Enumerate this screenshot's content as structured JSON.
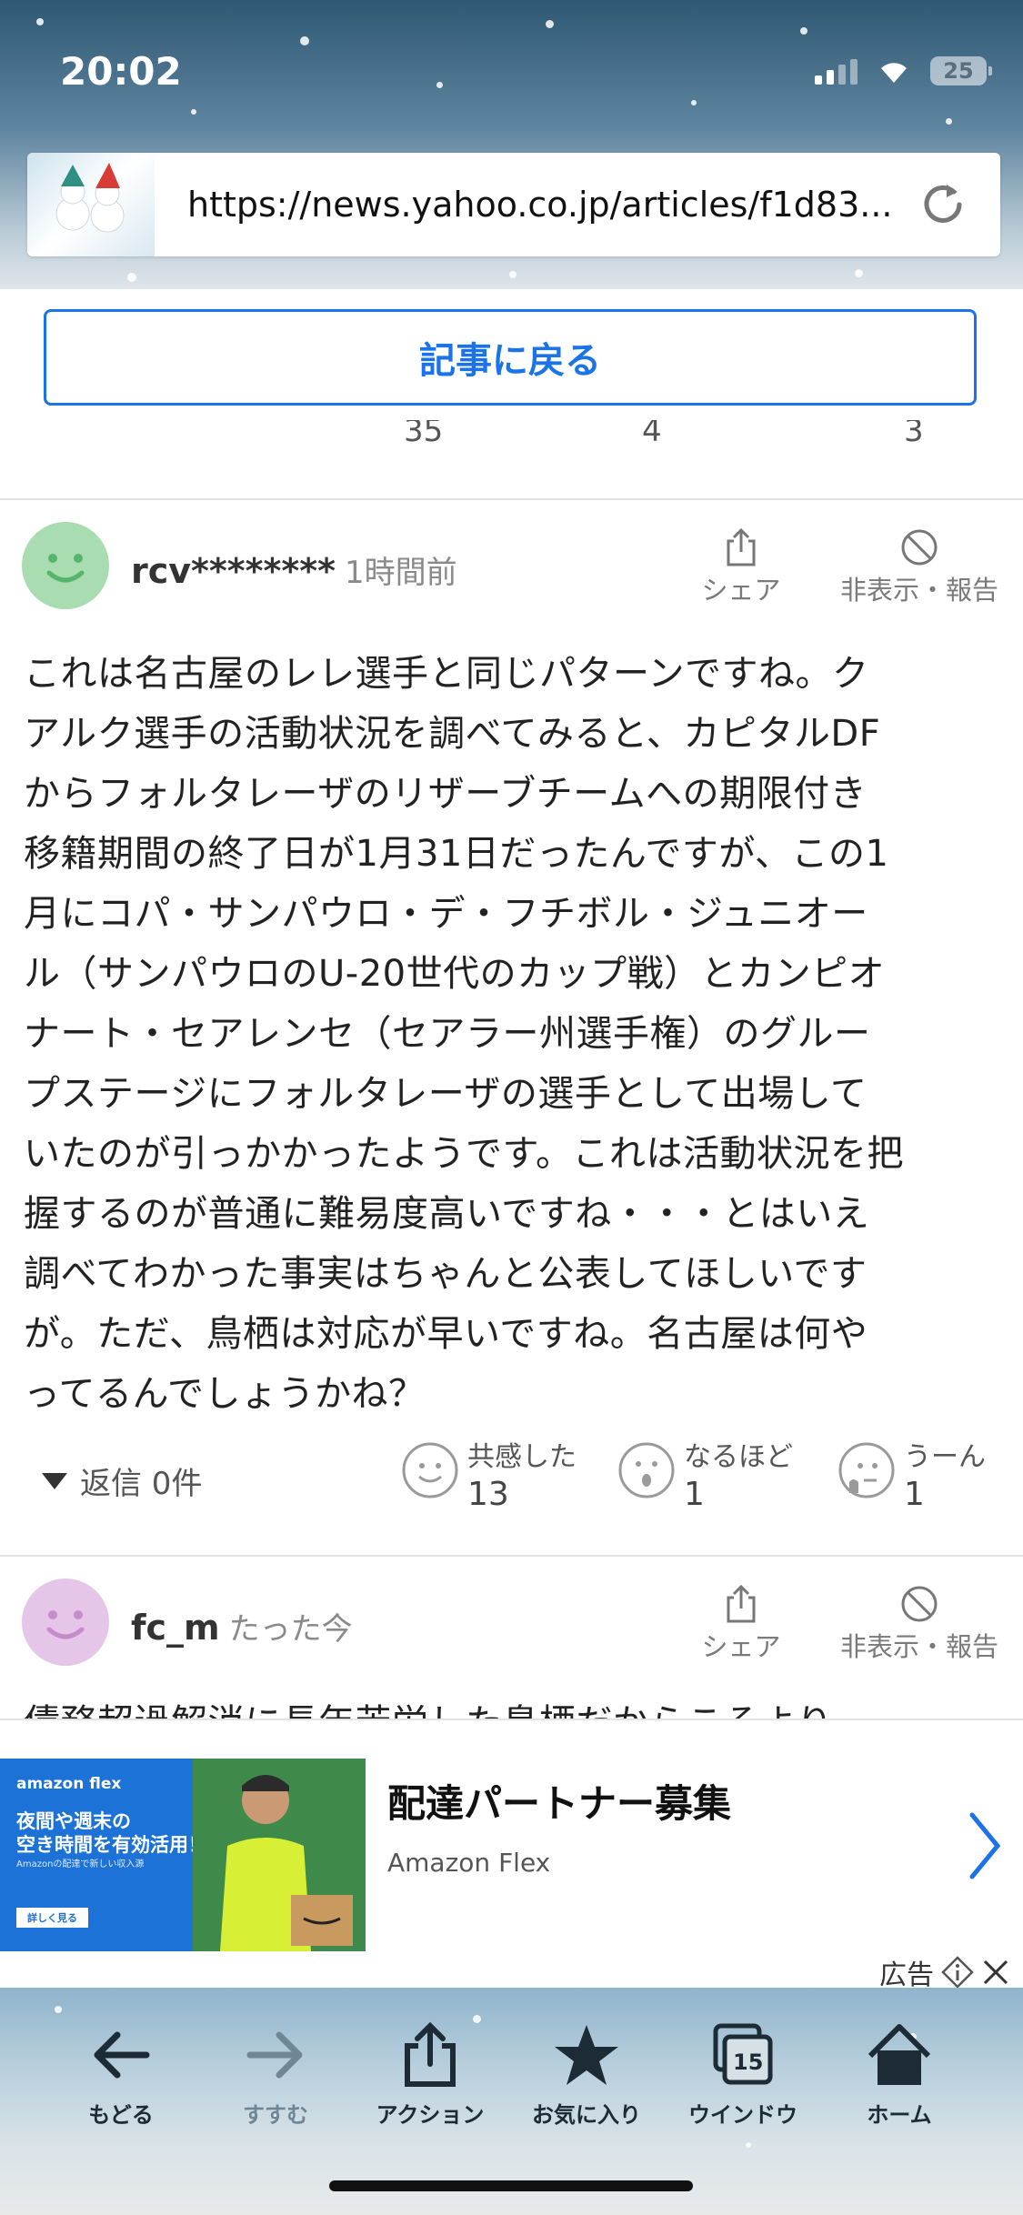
{
  "status": {
    "time": "20:02",
    "battery": "25"
  },
  "browser": {
    "url": "https://news.yahoo.co.jp/articles/f1d83..."
  },
  "back_button": "記事に戻る",
  "partial_counts": [
    "35",
    "4",
    "3"
  ],
  "comments": [
    {
      "user": "rcv********",
      "time": "1時間前",
      "share_label": "シェア",
      "hide_label": "非表示・報告",
      "lines": [
        "これは名古屋のレレ選手と同じパターンですね。ク",
        "アルク選手の活動状況を調べてみると、カピタルDF",
        "からフォルタレーザのリザーブチームへの期限付き",
        "移籍期間の終了日が1月31日だったんですが、この1",
        "月にコパ・サンパウロ・デ・フチボル・ジュニオー",
        "ル（サンパウロのU-20世代のカップ戦）とカンピオ",
        "ナート・セアレンセ（セアラー州選手権）のグルー",
        "プステージにフォルタレーザの選手として出場して",
        "いたのが引っかかったようです。これは活動状況を把",
        "握するのが普通に難易度高いですね・・・とはいえ",
        "調べてわかった事実はちゃんと公表してほしいです",
        "が。ただ、鳥栖は対応が早いですね。名古屋は何や",
        "ってるんでしょうかね？"
      ],
      "reply": "返信 0件",
      "reactions": [
        {
          "label": "共感した",
          "count": "13"
        },
        {
          "label": "なるほど",
          "count": "1"
        },
        {
          "label": "うーん",
          "count": "1"
        }
      ]
    },
    {
      "user": "fc_m",
      "time": "たった今",
      "share_label": "シェア",
      "hide_label": "非表示・報告",
      "partial_line": "債務超過解消に長年苦労した鳥栖だからこそより一"
    }
  ],
  "ad": {
    "brand": "amazon flex",
    "image_copy": "夜間や週末の\n空き時間を有効活用！",
    "image_small": "Amazonの配達で新しい収入源",
    "image_cta": "詳しく見る",
    "title": "配達パートナー募集",
    "sponsor": "Amazon Flex",
    "label": "広告"
  },
  "toolbar": [
    {
      "label": "もどる",
      "icon": "back-arrow-icon"
    },
    {
      "label": "すすむ",
      "icon": "forward-arrow-icon"
    },
    {
      "label": "アクション",
      "icon": "share-icon"
    },
    {
      "label": "お気に入り",
      "icon": "star-icon"
    },
    {
      "label": "ウインドウ",
      "icon": "windows-icon",
      "badge": "15"
    },
    {
      "label": "ホーム",
      "icon": "home-icon"
    }
  ]
}
